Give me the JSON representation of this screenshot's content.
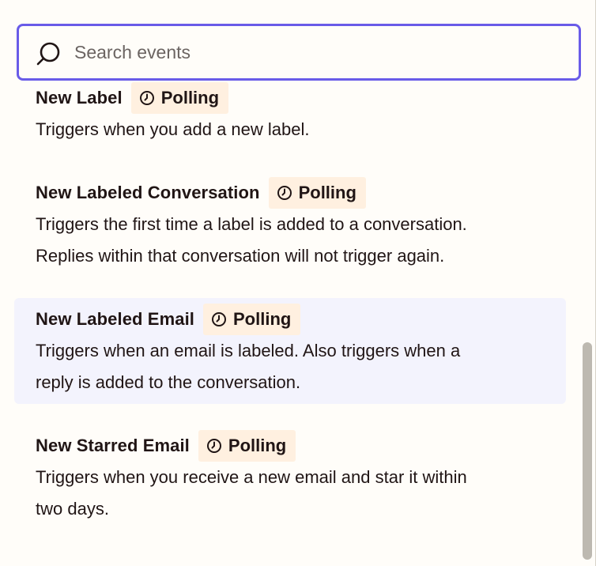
{
  "search": {
    "placeholder": "Search events",
    "value": ""
  },
  "events": [
    {
      "title": "New Label",
      "badge": "Polling",
      "description": "Triggers when you add a new label."
    },
    {
      "title": "New Labeled Conversation",
      "badge": "Polling",
      "description_lines": [
        "Triggers the first time a label is added to a conversation.",
        "Replies within that conversation will not trigger again."
      ]
    },
    {
      "title": "New Labeled Email",
      "badge": "Polling",
      "description_lines": [
        "Triggers when an email is labeled. Also triggers when a",
        "reply is added to the conversation."
      ]
    },
    {
      "title": "New Starred Email",
      "badge": "Polling",
      "description_lines": [
        "Triggers when you receive a new email and star it within",
        "two days."
      ]
    }
  ],
  "colors": {
    "accent": "#695be8",
    "badge_bg": "#fff0e0",
    "selected_bg": "#f3f3fd",
    "background": "#fffdf9"
  },
  "icons": {
    "search": "search-icon",
    "badge": "clock-icon"
  }
}
